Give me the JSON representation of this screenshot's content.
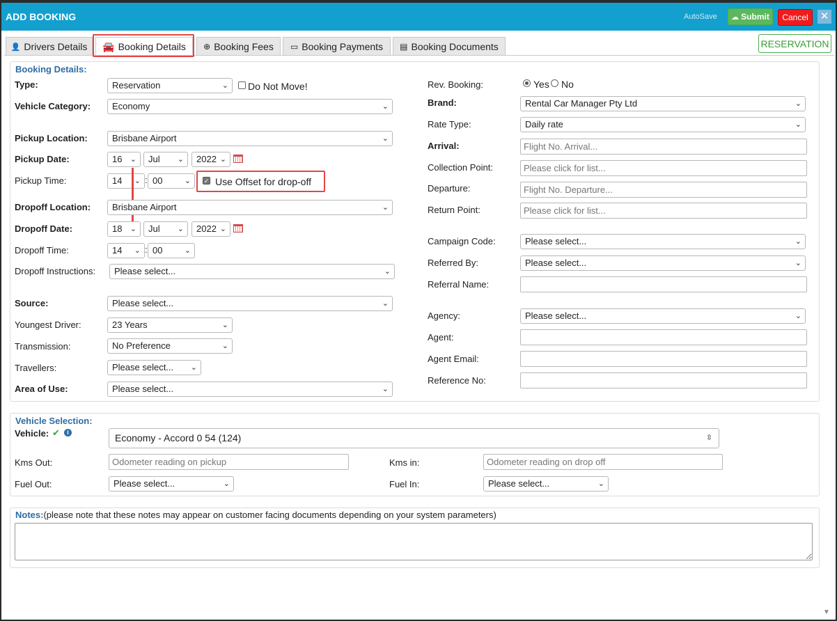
{
  "window": {
    "title": "ADD BOOKING",
    "autosave": "AutoSave",
    "submit": "Submit",
    "cancel": "Cancel",
    "close": "✕"
  },
  "tabs": [
    {
      "label": "Drivers Details",
      "icon": "user-icon"
    },
    {
      "label": "Booking Details",
      "icon": "car-icon",
      "active": true
    },
    {
      "label": "Booking Fees",
      "icon": "plus-circle-icon"
    },
    {
      "label": "Booking Payments",
      "icon": "credit-card-icon"
    },
    {
      "label": "Booking Documents",
      "icon": "document-icon"
    }
  ],
  "status_badge": "RESERVATION",
  "booking": {
    "section_title": "Booking Details:",
    "type": {
      "label": "Type:",
      "value": "Reservation"
    },
    "do_not_move": "Do Not Move!",
    "vehicle_category": {
      "label": "Vehicle Category:",
      "value": "Economy"
    },
    "pickup_location": {
      "label": "Pickup Location:",
      "value": "Brisbane Airport"
    },
    "pickup_date": {
      "label": "Pickup Date:",
      "day": "16",
      "month": "Jul",
      "year": "2022"
    },
    "pickup_time": {
      "label": "Pickup Time:",
      "hour": "14",
      "minute": "00"
    },
    "use_offset": "Use Offset for drop-off",
    "dropoff_location": {
      "label": "Dropoff Location:",
      "value": "Brisbane Airport"
    },
    "dropoff_date": {
      "label": "Dropoff Date:",
      "day": "18",
      "month": "Jul",
      "year": "2022"
    },
    "dropoff_time": {
      "label": "Dropoff Time:",
      "hour": "14",
      "minute": "00"
    },
    "dropoff_instructions": {
      "label": "Dropoff Instructions:",
      "value": "Please select..."
    },
    "source": {
      "label": "Source:",
      "value": "Please select..."
    },
    "youngest_driver": {
      "label": "Youngest Driver:",
      "value": "23 Years"
    },
    "transmission": {
      "label": "Transmission:",
      "value": "No Preference"
    },
    "travellers": {
      "label": "Travellers:",
      "value": "Please select..."
    },
    "area_of_use": {
      "label": "Area of Use:",
      "value": "Please select..."
    },
    "rev_booking": {
      "label": "Rev. Booking:",
      "yes": "Yes",
      "no": "No"
    },
    "brand": {
      "label": "Brand:",
      "value": "Rental Car Manager Pty Ltd"
    },
    "rate_type": {
      "label": "Rate Type:",
      "value": "Daily rate"
    },
    "arrival": {
      "label": "Arrival:",
      "placeholder": "Flight No. Arrival..."
    },
    "collection_point": {
      "label": "Collection Point:",
      "placeholder": "Please click for list..."
    },
    "departure": {
      "label": "Departure:",
      "placeholder": "Flight No. Departure..."
    },
    "return_point": {
      "label": "Return Point:",
      "placeholder": "Please click for list..."
    },
    "campaign_code": {
      "label": "Campaign Code:",
      "value": "Please select..."
    },
    "referred_by": {
      "label": "Referred By:",
      "value": "Please select..."
    },
    "referral_name": {
      "label": "Referral Name:"
    },
    "agency": {
      "label": "Agency:",
      "value": "Please select..."
    },
    "agent": {
      "label": "Agent:"
    },
    "agent_email": {
      "label": "Agent Email:"
    },
    "reference_no": {
      "label": "Reference No:"
    }
  },
  "vehicle": {
    "section_title": "Vehicle Selection:",
    "vehicle": {
      "label": "Vehicle:",
      "value": "Economy - Accord 0 54 (124)"
    },
    "kms_out": {
      "label": "Kms Out:",
      "placeholder": "Odometer reading on pickup"
    },
    "kms_in": {
      "label": "Kms in:",
      "placeholder": "Odometer reading on drop off"
    },
    "fuel_out": {
      "label": "Fuel Out:",
      "value": "Please select..."
    },
    "fuel_in": {
      "label": "Fuel In:",
      "value": "Please select..."
    }
  },
  "notes": {
    "title": "Notes:",
    "hint": "(please note that these notes may appear on customer facing documents depending on your system parameters)"
  },
  "colors": {
    "header": "#13a0ce",
    "submit": "#5cb85c",
    "cancel": "#ee1c1c",
    "highlight": "#e54545",
    "section_title": "#2e6da4"
  }
}
